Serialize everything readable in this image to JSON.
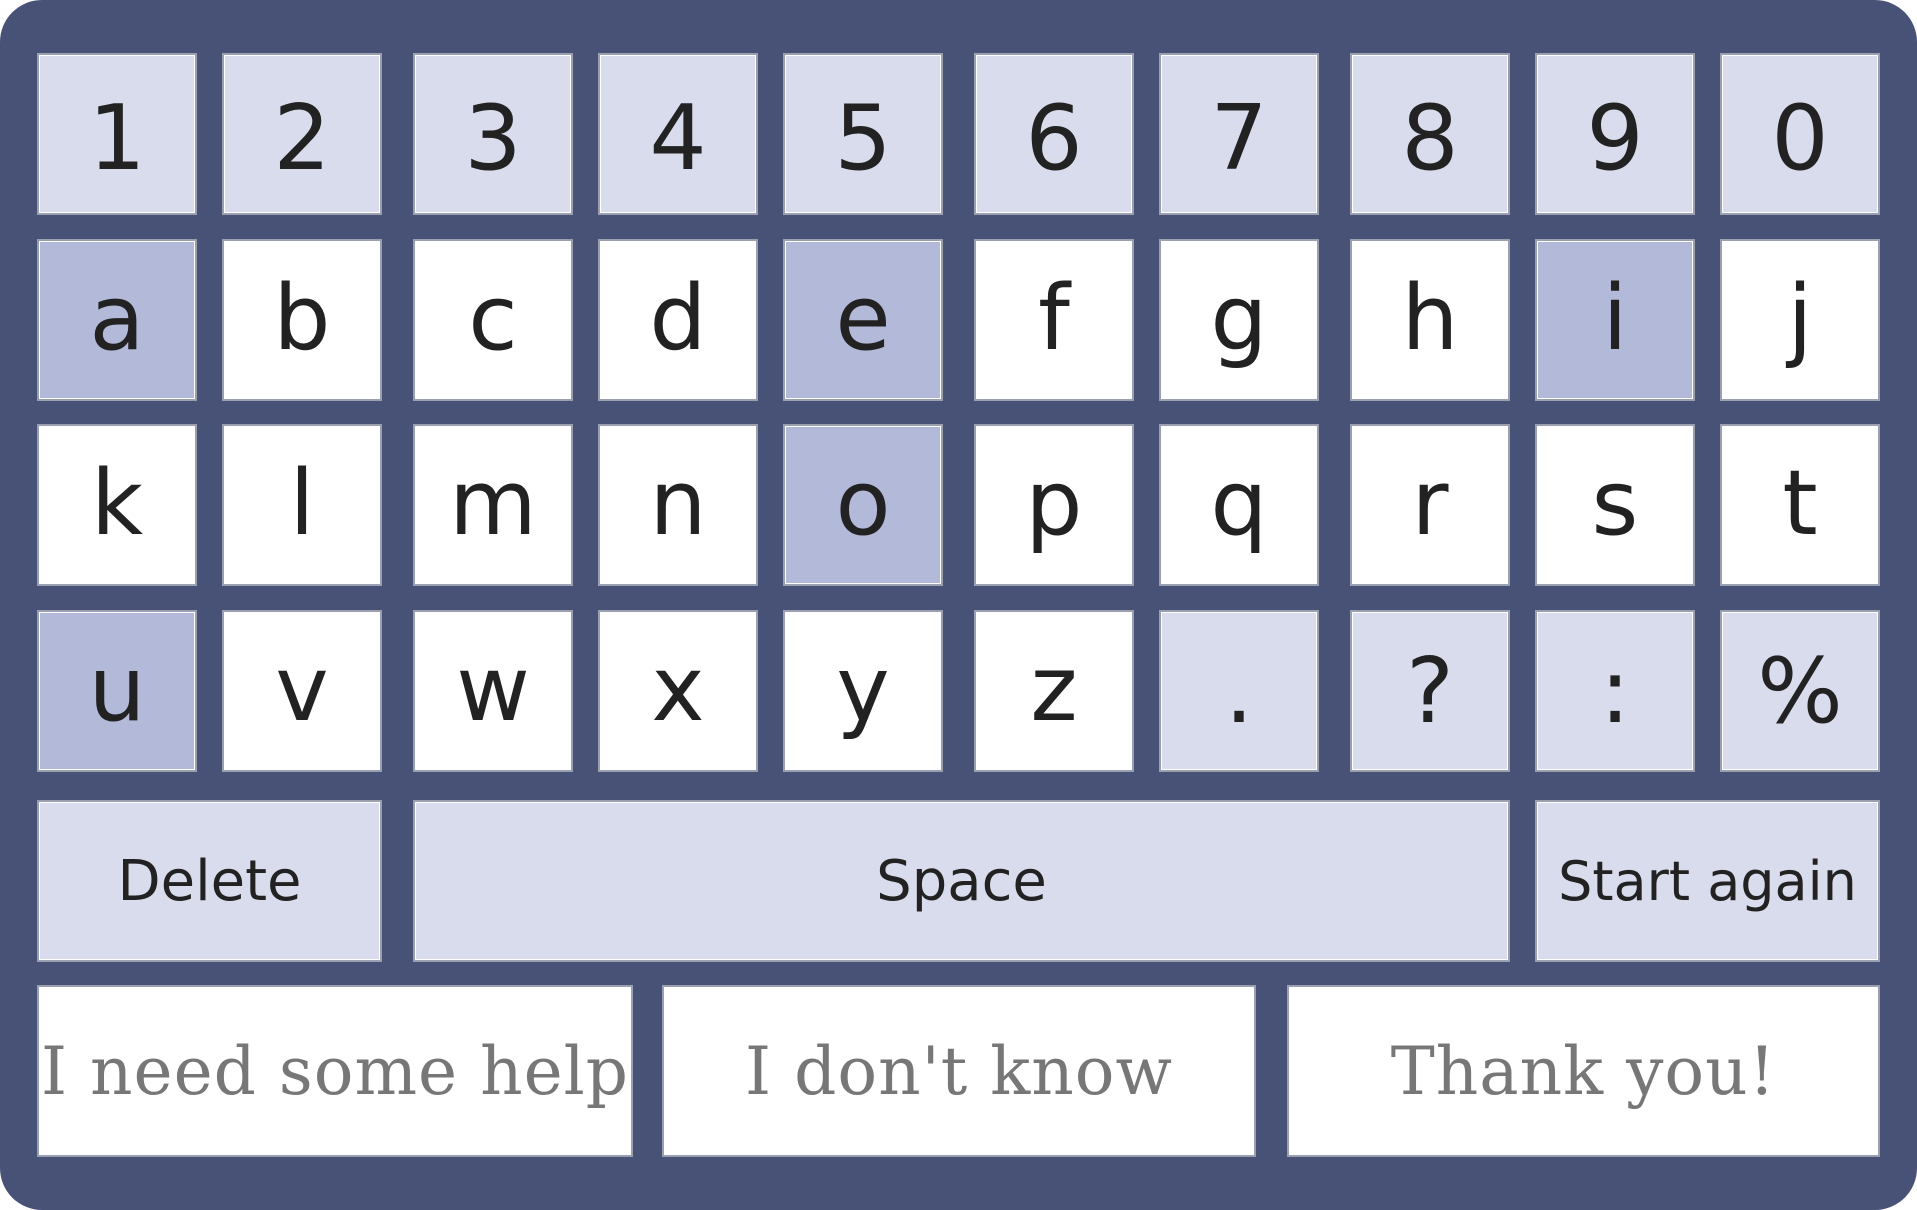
{
  "keyboard": {
    "numbers": [
      "1",
      "2",
      "3",
      "4",
      "5",
      "6",
      "7",
      "8",
      "9",
      "0"
    ],
    "row_a_j": [
      "a",
      "b",
      "c",
      "d",
      "e",
      "f",
      "g",
      "h",
      "i",
      "j"
    ],
    "row_k_t": [
      "k",
      "l",
      "m",
      "n",
      "o",
      "p",
      "q",
      "r",
      "s",
      "t"
    ],
    "row_u_end": [
      "u",
      "v",
      "w",
      "x",
      "y",
      "z",
      ".",
      "?",
      ":",
      "%"
    ],
    "actions": {
      "delete": "Delete",
      "space": "Space",
      "start_again": "Start again"
    },
    "phrases": [
      "I need some help",
      "I don't know",
      "Thank you!"
    ],
    "highlighted_vowels": [
      "a",
      "e",
      "i",
      "o",
      "u"
    ]
  },
  "colors": {
    "frame": "#485277",
    "number_key": "#d9dcec",
    "letter_key": "#ffffff",
    "vowel_key": "#b3b9d8",
    "punct_key": "#d9dcec",
    "action_key": "#d9dcec",
    "phrase_text": "#777777"
  }
}
